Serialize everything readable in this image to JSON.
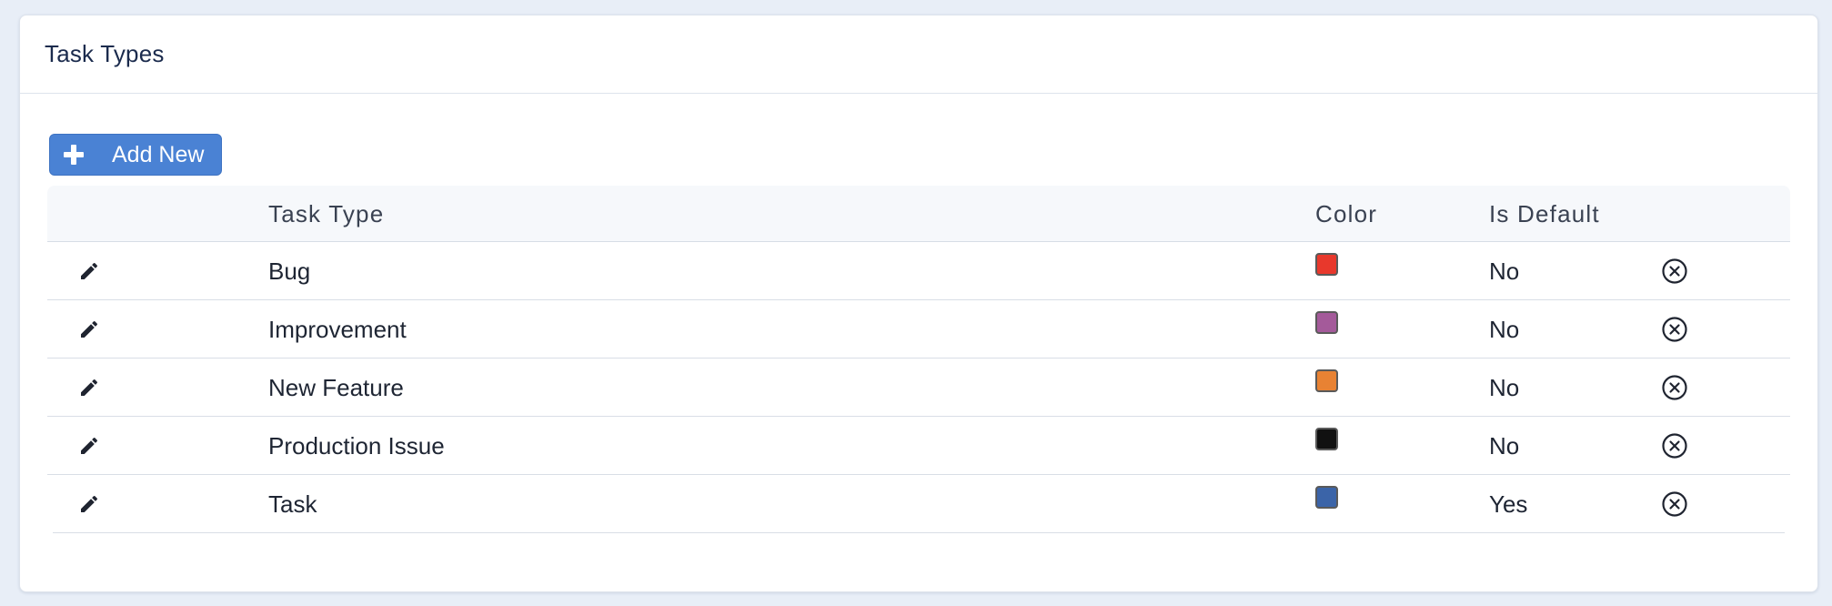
{
  "card": {
    "title": "Task Types"
  },
  "toolbar": {
    "add_label": "Add New"
  },
  "table": {
    "headers": {
      "task_type": "Task Type",
      "color": "Color",
      "is_default": "Is Default"
    },
    "rows": [
      {
        "name": "Bug",
        "color": "#e8382c",
        "is_default": "No"
      },
      {
        "name": "Improvement",
        "color": "#a45a9a",
        "is_default": "No"
      },
      {
        "name": "New Feature",
        "color": "#e88233",
        "is_default": "No"
      },
      {
        "name": "Production Issue",
        "color": "#111111",
        "is_default": "No"
      },
      {
        "name": "Task",
        "color": "#3b64a8",
        "is_default": "Yes"
      }
    ]
  },
  "icons": {
    "add": "plus-icon",
    "edit": "pencil-icon",
    "delete": "circle-x-icon"
  },
  "colors": {
    "primary": "#4a82d4",
    "background": "#e8eef7"
  }
}
